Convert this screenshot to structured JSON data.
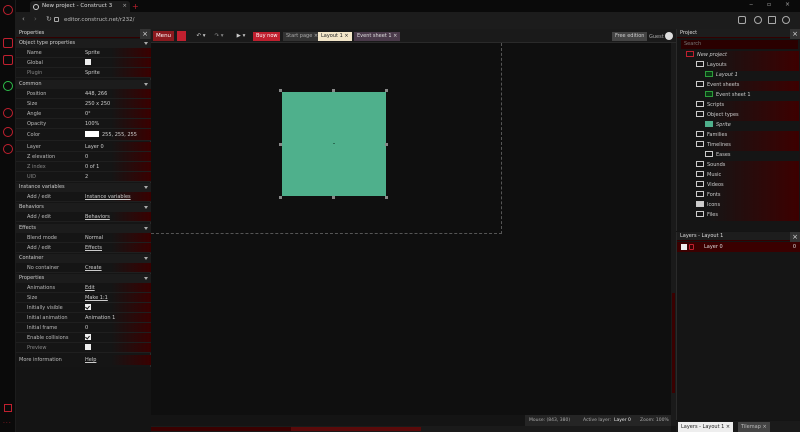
{
  "browser": {
    "tab_title": "New project - Construct 3",
    "new_tab": "+",
    "url": "editor.construct.net/r232/"
  },
  "toolbar": {
    "menu_label": "Menu",
    "buy_label": "Buy now",
    "tabs": [
      {
        "label": "Start page"
      },
      {
        "label": "Layout 1"
      },
      {
        "label": "Event sheet 1"
      }
    ],
    "edition": "Free edition",
    "user": "Guest"
  },
  "properties": {
    "title": "Properties",
    "object_type_section": "Object type properties",
    "name_label": "Name",
    "name_value": "Sprite",
    "global_label": "Global",
    "plugin_label": "Plugin",
    "plugin_value": "Sprite",
    "common_section": "Common",
    "position_label": "Position",
    "position_value": "448, 266",
    "size_label": "Size",
    "size_value": "250 x 250",
    "angle_label": "Angle",
    "angle_value": "0°",
    "opacity_label": "Opacity",
    "opacity_value": "100%",
    "color_label": "Color",
    "color_value": "255, 255, 255",
    "layer_label": "Layer",
    "layer_value": "Layer 0",
    "zelev_label": "Z elevation",
    "zelev_value": "0",
    "zindex_label": "Z index",
    "zindex_value": "0 of 1",
    "uid_label": "UID",
    "uid_value": "2",
    "instvar_section": "Instance variables",
    "instvar_add_label": "Add / edit",
    "instvar_add_value": "Instance variables",
    "behaviors_section": "Behaviors",
    "beh_add_label": "Add / edit",
    "beh_add_value": "Behaviors",
    "effects_section": "Effects",
    "blend_label": "Blend mode",
    "blend_value": "Normal",
    "eff_add_label": "Add / edit",
    "eff_add_value": "Effects",
    "container_section": "Container",
    "container_label": "No container",
    "container_value": "Create",
    "props_section": "Properties",
    "anim_label": "Animations",
    "anim_value": "Edit",
    "psize_label": "Size",
    "psize_value": "Make 1:1",
    "visible_label": "Initially visible",
    "initanim_label": "Initial animation",
    "initanim_value": "Animation 1",
    "initframe_label": "Initial frame",
    "initframe_value": "0",
    "collisions_label": "Enable collisions",
    "preview_label": "Preview",
    "more_label": "More information",
    "more_value": "Help"
  },
  "project": {
    "title": "Project",
    "search_placeholder": "Search",
    "root": "New project",
    "layouts": "Layouts",
    "layout1": "Layout 1",
    "event_sheets": "Event sheets",
    "event_sheet1": "Event sheet 1",
    "scripts": "Scripts",
    "object_types": "Object types",
    "sprite": "Sprite",
    "families": "Families",
    "timelines": "Timelines",
    "eases": "Eases",
    "sounds": "Sounds",
    "music": "Music",
    "videos": "Videos",
    "fonts": "Fonts",
    "icons": "Icons",
    "files": "Files"
  },
  "layers": {
    "title": "Layers - Layout 1",
    "layer0": "Layer 0",
    "layer0_count": "0",
    "bottom_tab_active": "Layers - Layout 1",
    "bottom_tab_other": "Tilemap"
  },
  "status": {
    "mouse": "Mouse: (843, 380)",
    "active_layer_label": "Active layer:",
    "active_layer": "Layer 0",
    "zoom": "Zoom: 100%"
  },
  "colors": {
    "accent": "#c0202f",
    "sprite": "#4fb08c"
  }
}
